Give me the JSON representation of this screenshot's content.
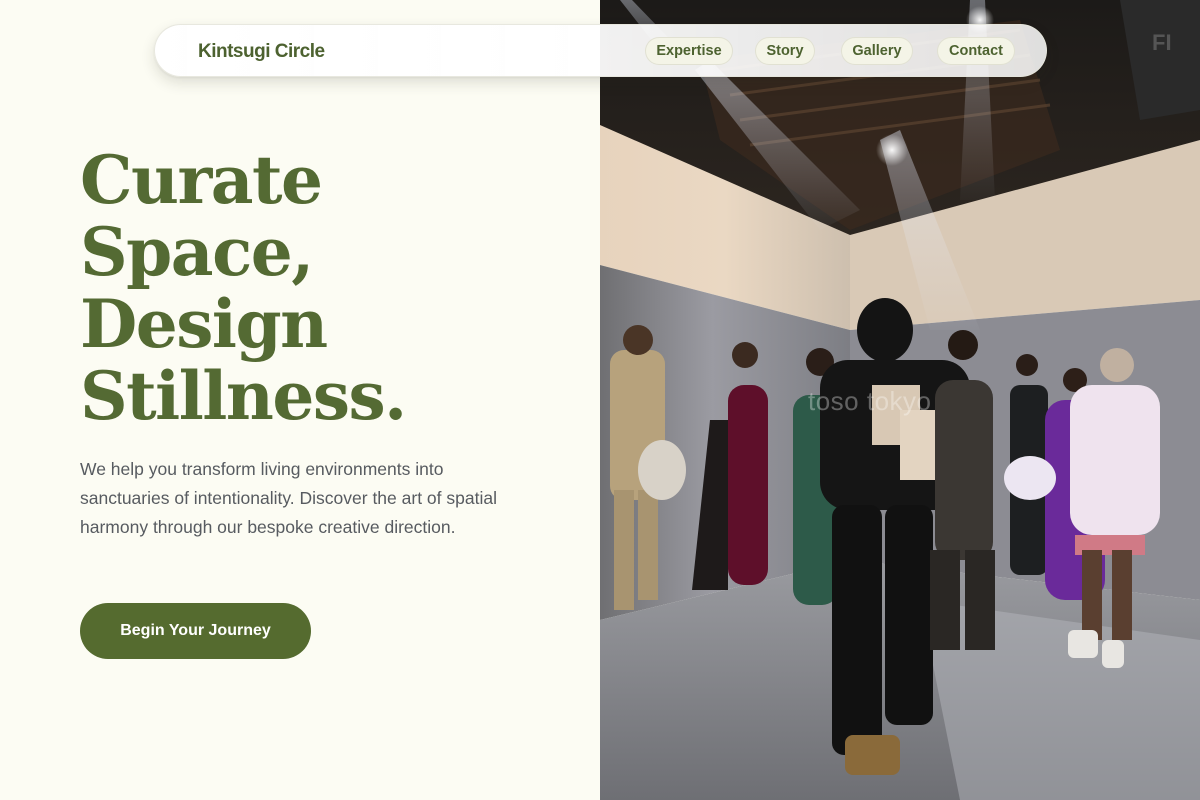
{
  "nav": {
    "brand": "Kintsugi Circle",
    "links": [
      "Expertise",
      "Story",
      "Gallery",
      "Contact"
    ]
  },
  "hero": {
    "title_lines": [
      "Curate",
      "Space,",
      "Design",
      "Stillness."
    ],
    "description": "We help you transform living environments into sanctuaries of intentionality. Discover the art of spatial harmony through our bespoke creative direction.",
    "cta_label": "Begin Your Journey"
  },
  "photo": {
    "watermark": "toso tokyo"
  },
  "colors": {
    "accent": "#556b2f",
    "title": "#546a33",
    "background": "#fcfcf3",
    "body_text": "#575b60"
  }
}
